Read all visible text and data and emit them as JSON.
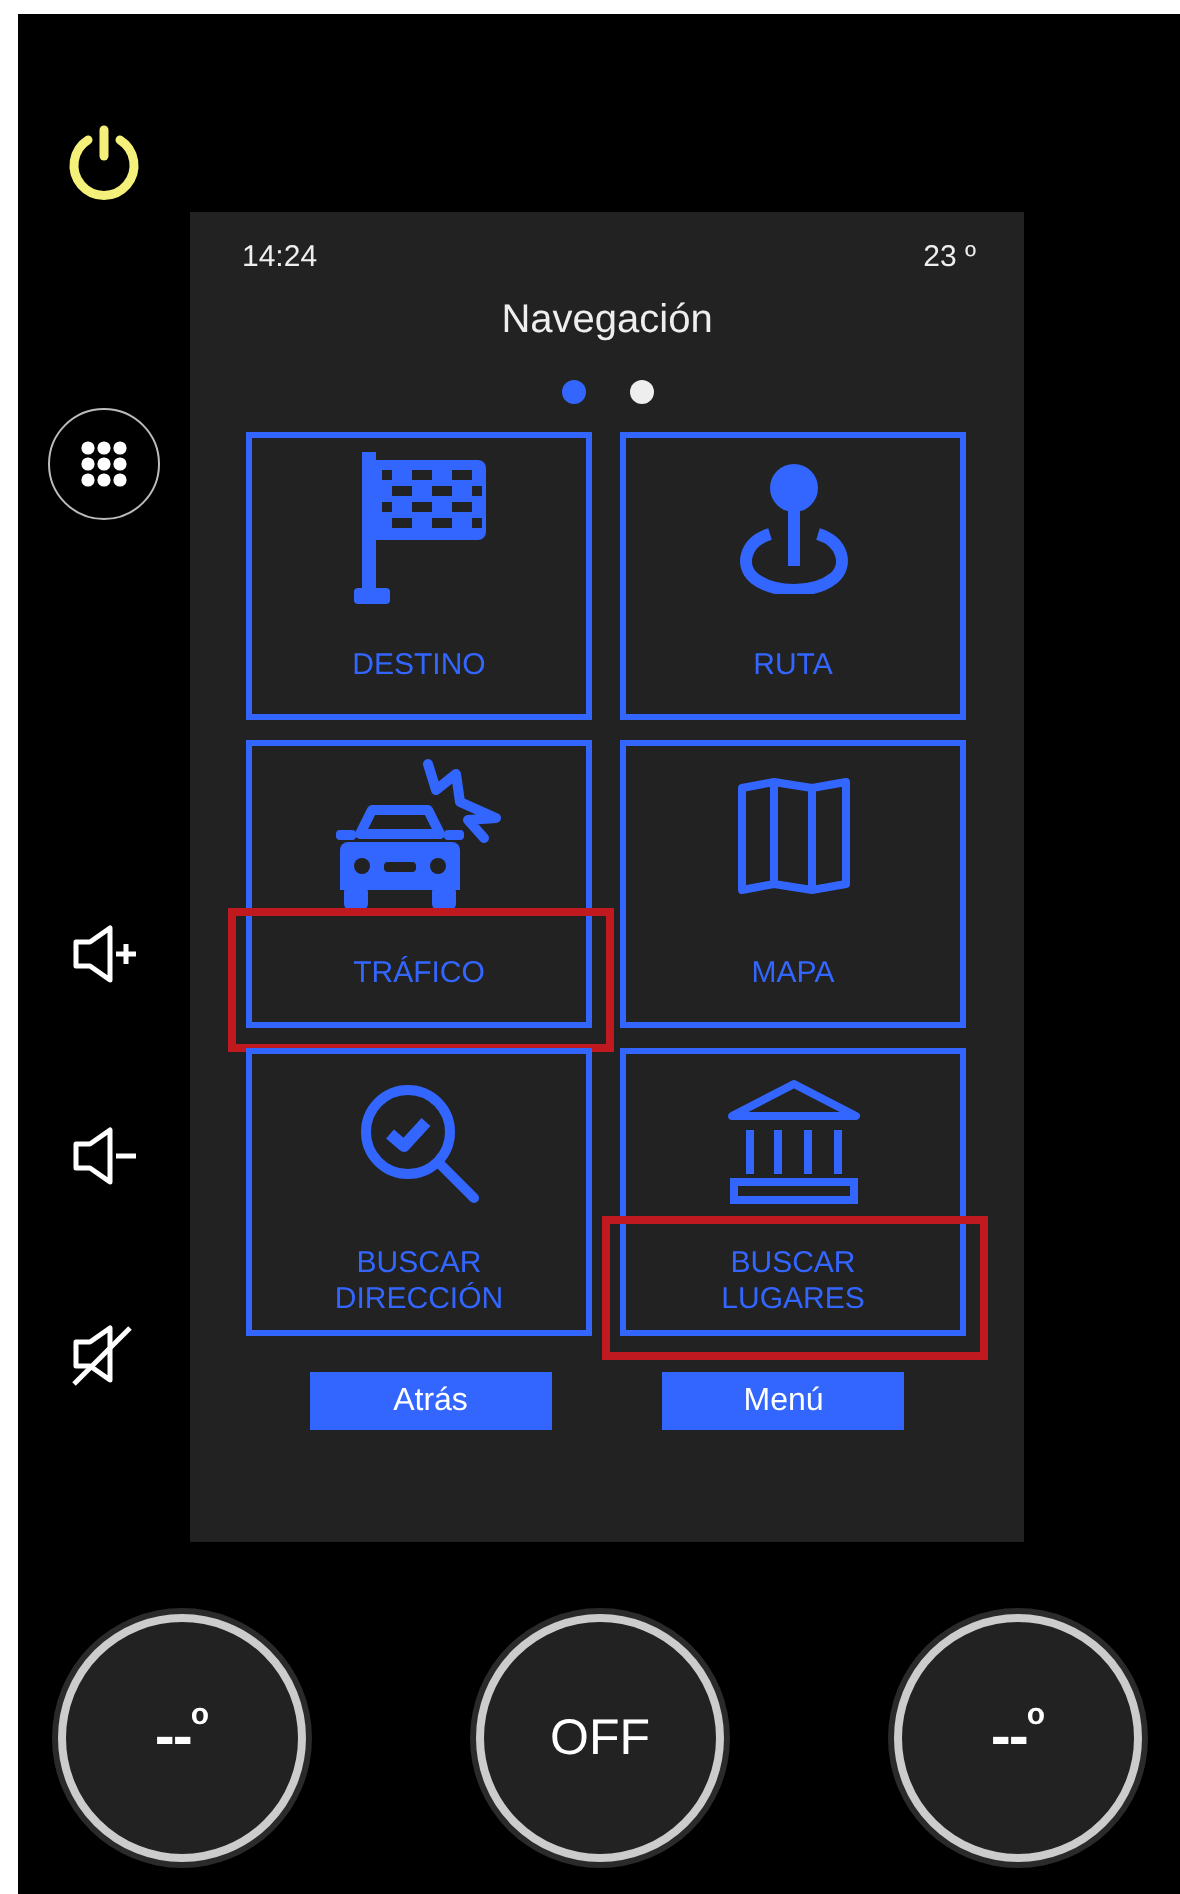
{
  "status": {
    "time": "14:24",
    "temperature": "23 º"
  },
  "title": "Navegación",
  "page_dots": [
    {
      "selected": true
    },
    {
      "selected": false
    }
  ],
  "tiles": [
    {
      "label": "DESTINO",
      "highlighted": false
    },
    {
      "label": "RUTA",
      "highlighted": false
    },
    {
      "label": "TRÁFICO",
      "highlighted": true
    },
    {
      "label": "MAPA",
      "highlighted": false
    },
    {
      "label": "BUSCAR\nDIRECCIÓN",
      "highlighted": false
    },
    {
      "label": "BUSCAR\nLUGARES",
      "highlighted": true
    }
  ],
  "buttons": [
    "Atrás",
    "Menú"
  ],
  "climate": [
    {
      "kind": "temperature",
      "value": "--",
      "unit": "o"
    },
    {
      "kind": "mode",
      "value": "OFF"
    },
    {
      "kind": "temperature",
      "value": "--",
      "unit": "o"
    }
  ]
}
